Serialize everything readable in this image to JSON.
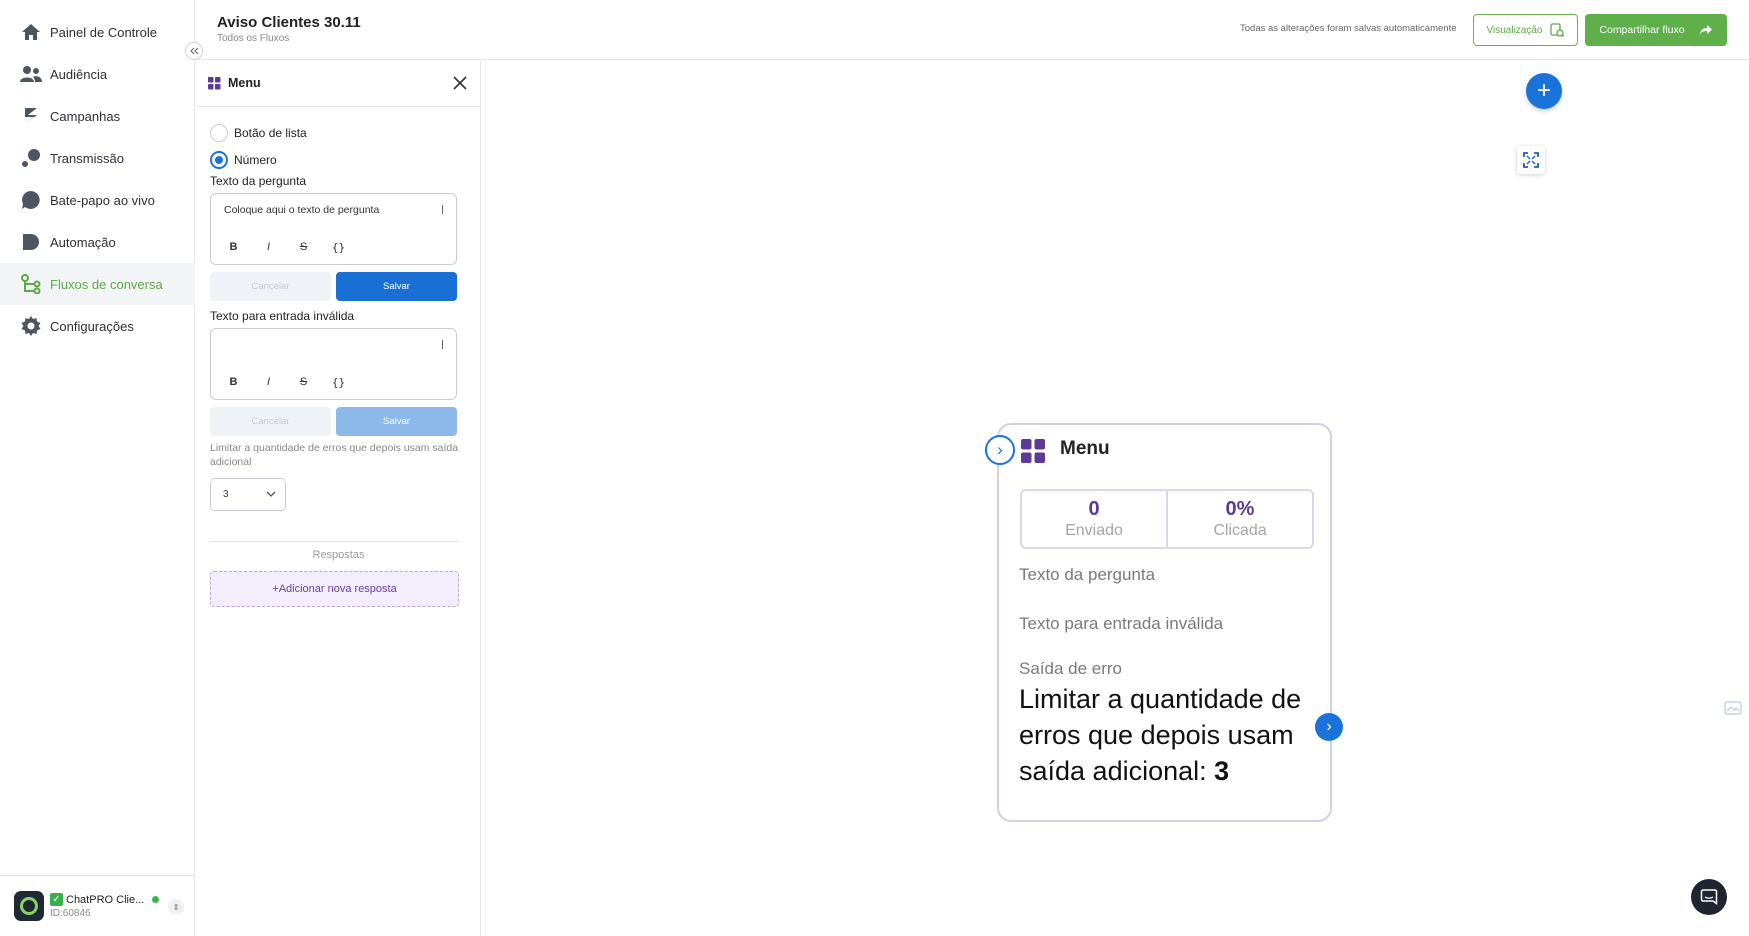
{
  "sidebar": {
    "items": [
      {
        "label": "Painel de Controle",
        "icon": "home-icon"
      },
      {
        "label": "Audiência",
        "icon": "users-icon"
      },
      {
        "label": "Campanhas",
        "icon": "campaign-icon"
      },
      {
        "label": "Transmissão",
        "icon": "broadcast-icon"
      },
      {
        "label": "Bate-papo ao vivo",
        "icon": "chat-icon"
      },
      {
        "label": "Automação",
        "icon": "automation-icon"
      },
      {
        "label": "Fluxos de conversa",
        "icon": "flow-icon",
        "active": true
      },
      {
        "label": "Configurações",
        "icon": "gear-icon"
      }
    ],
    "account": {
      "check": "✓",
      "name": "ChatPRO Clie...",
      "id": "ID:60846"
    }
  },
  "header": {
    "title": "Aviso Clientes 30.11",
    "breadcrumb": "Todos os Fluxos",
    "saved_note": "Todas as alterações foram salvas automaticamente",
    "preview_label": "Visualização",
    "share_label": "Compartilhar fluxo"
  },
  "panel": {
    "title": "Menu",
    "radio_list_label": "Botão de lista",
    "radio_number_label": "Número",
    "question_label": "Texto da pergunta",
    "question_value": "Coloque aqui o texto de pergunta",
    "invalid_label": "Texto para entrada inválida",
    "invalid_value": "",
    "tools": {
      "bold": "B",
      "italic": "I",
      "strike": "S",
      "variable": "{}"
    },
    "cancel_label": "Cancelar",
    "save_label": "Salvar",
    "limit_note": "Limitar a quantidade de erros que depois usam saída adicional",
    "limit_value": "3",
    "responses_label": "Respostas",
    "add_response_label": "+Adicionar nova resposta"
  },
  "node": {
    "title": "Menu",
    "sent_value": "0",
    "sent_label": "Enviado",
    "clicked_value": "0%",
    "clicked_label": "Clicada",
    "question_label": "Texto da pergunta",
    "invalid_label": "Texto para entrada inválida",
    "error_label": "Saída de erro",
    "limit_text": "Limitar a quantidade de erros que depois usam saída adicional:",
    "limit_value": "3"
  },
  "colors": {
    "accent_green": "#5fb04b",
    "primary_blue": "#1a73d9",
    "purple": "#5c3a95"
  }
}
